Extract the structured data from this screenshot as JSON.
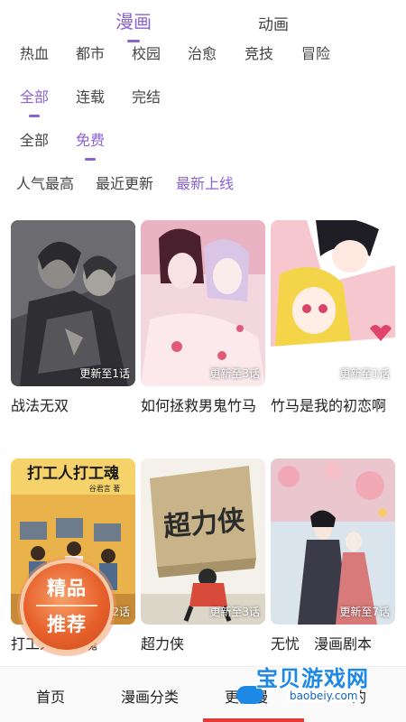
{
  "top_tabs": [
    {
      "label": "漫画",
      "active": true
    },
    {
      "label": "动画",
      "active": false
    }
  ],
  "genres": [
    "热血",
    "都市",
    "校园",
    "治愈",
    "竞技",
    "冒险"
  ],
  "status_filters": [
    {
      "label": "全部",
      "active": true
    },
    {
      "label": "连载",
      "active": false
    },
    {
      "label": "完结",
      "active": false
    }
  ],
  "price_filters": [
    {
      "label": "全部",
      "active": false
    },
    {
      "label": "免费",
      "active": true
    }
  ],
  "sort_filters": [
    {
      "label": "人气最高",
      "active": false
    },
    {
      "label": "最近更新",
      "active": false
    },
    {
      "label": "最新上线",
      "active": true
    }
  ],
  "comics": [
    {
      "title": "战法无双",
      "update": "更新至1话"
    },
    {
      "title": "如何拯救男鬼竹马",
      "update": "更新至3话"
    },
    {
      "title": "竹马是我的初恋啊",
      "update": "更新至1话"
    },
    {
      "title": "打工人打工魂",
      "update": "2话",
      "cover_text": "打工人打工魂",
      "cover_author": "谷君言 著"
    },
    {
      "title": "超力侠",
      "update": "更新至3话",
      "cover_text": "超力侠"
    },
    {
      "title": "无忧",
      "update": "更新至7话"
    }
  ],
  "comics_title_6_tail": "漫画剧本",
  "promo_badge": {
    "line1": "精品",
    "line2": "推荐"
  },
  "bottom_nav": [
    {
      "label": "首页"
    },
    {
      "label": "漫画分类"
    },
    {
      "label": "更多漫",
      "active": true
    },
    {
      "label": "的"
    }
  ],
  "watermark": {
    "top": "宝贝游戏网",
    "bottom": "baobeiy.com"
  },
  "colors": {
    "accent": "#8a63d2",
    "nav_active": "#e53935"
  }
}
